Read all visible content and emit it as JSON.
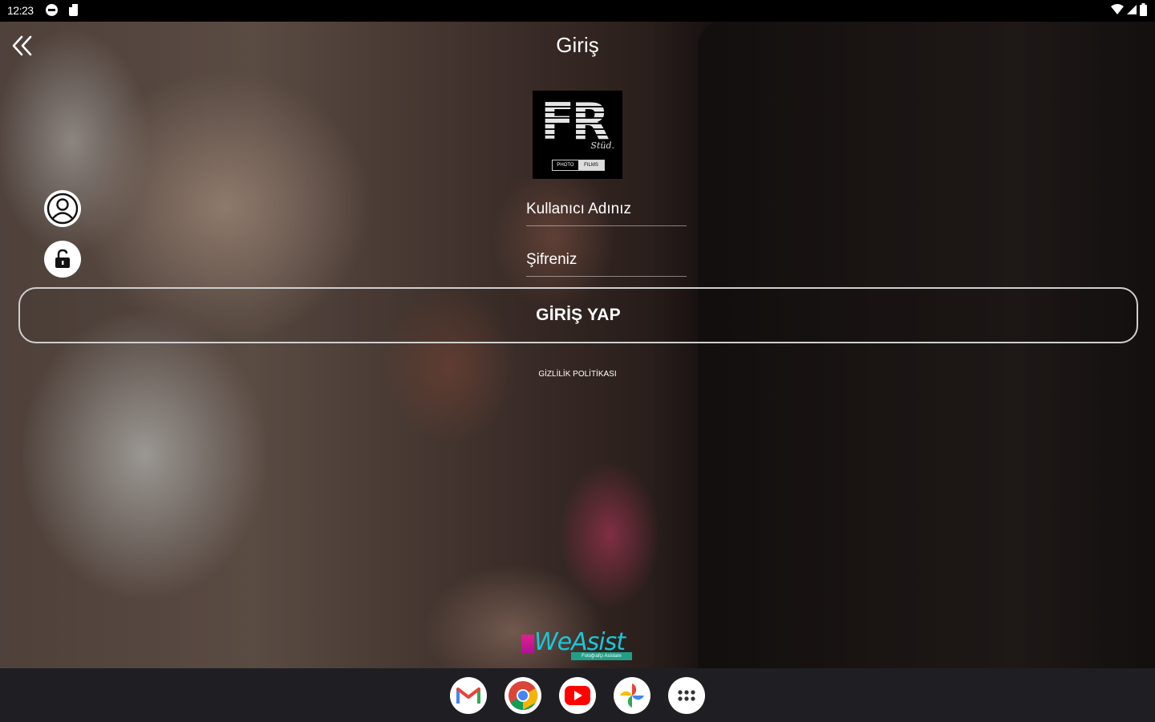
{
  "status_bar": {
    "time": "12:23",
    "icons": [
      "dnd-icon",
      "sd-card-icon",
      "wifi-icon",
      "signal-icon",
      "battery-icon"
    ]
  },
  "header": {
    "title": "Giriş",
    "back_icon": "double-chevron-left-icon"
  },
  "logo": {
    "main": "FR",
    "script": "Stüd.",
    "badge_left": "PHOTO",
    "badge_right": "FILMS"
  },
  "form": {
    "username_placeholder": "Kullanıcı Adınız",
    "password_placeholder": "Şifreniz",
    "username_icon": "user-circle-icon",
    "password_icon": "unlock-icon",
    "submit_label": "GİRİŞ YAP",
    "privacy_link": "GİZLİLİK POLİTİKASI"
  },
  "footer_brand": {
    "name": "WeAsist",
    "tagline": "Fotoğrafçı Asistanı"
  },
  "taskbar": {
    "apps": [
      "gmail-icon",
      "chrome-icon",
      "youtube-icon",
      "photos-icon",
      "app-drawer-icon"
    ]
  },
  "colors": {
    "button_border": "#cfcfcf",
    "brand_cyan": "#18c7d8",
    "brand_magenta": "#e0208c",
    "taskbar_bg": "#1f1f23"
  }
}
